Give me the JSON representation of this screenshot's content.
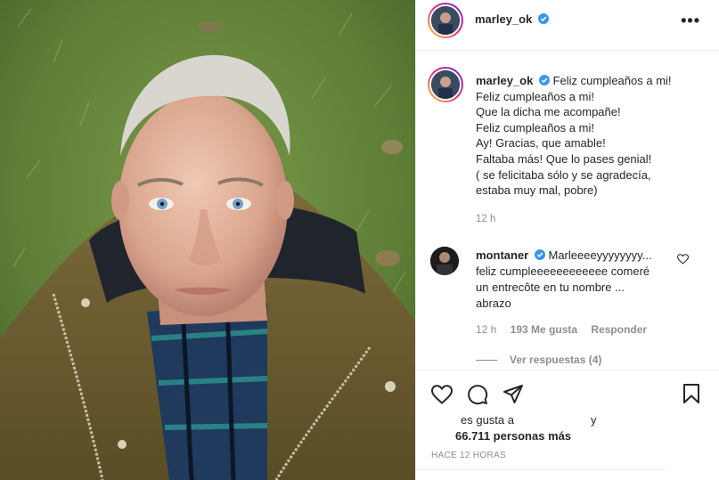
{
  "post": {
    "username": "marley_ok",
    "verified": true
  },
  "caption": {
    "username": "marley_ok",
    "lines": [
      "Feliz cumpleaños a mi!",
      "Feliz cumpleaños a mi!",
      "Que la dicha me acompañe!",
      "Feliz cumpleaños a mi!",
      "Ay! Gracias, que amable!",
      "Faltaba más! Que lo pases genial!",
      "( se felicitaba sólo y se agradecía,",
      "estaba muy mal, pobre)"
    ],
    "time": "12 h"
  },
  "comment": {
    "username": "montaner",
    "lines": [
      "Marleeeeyyyyyyyy...",
      "feliz cumpleeeeeeeeeeee comeré",
      "un entrecôte en tu nombre ...",
      "abrazo"
    ],
    "time": "12 h",
    "likes": "193 Me gusta",
    "reply": "Responder",
    "view_replies": "Ver respuestas (4)"
  },
  "likes": {
    "prefix": "es gusta a",
    "suffix": "y",
    "count_text": "66.711 personas más"
  },
  "timestamp": "HACE 12 HORAS",
  "icons": {
    "more": "more-options-icon",
    "verified": "verified-badge-icon",
    "like": "heart-icon",
    "comment": "comment-bubble-icon",
    "share": "paper-plane-icon",
    "save": "bookmark-icon"
  },
  "colors": {
    "verified_blue": "#3897f0",
    "text": "#262626",
    "muted": "#8e8e8e",
    "border": "#efefef"
  }
}
